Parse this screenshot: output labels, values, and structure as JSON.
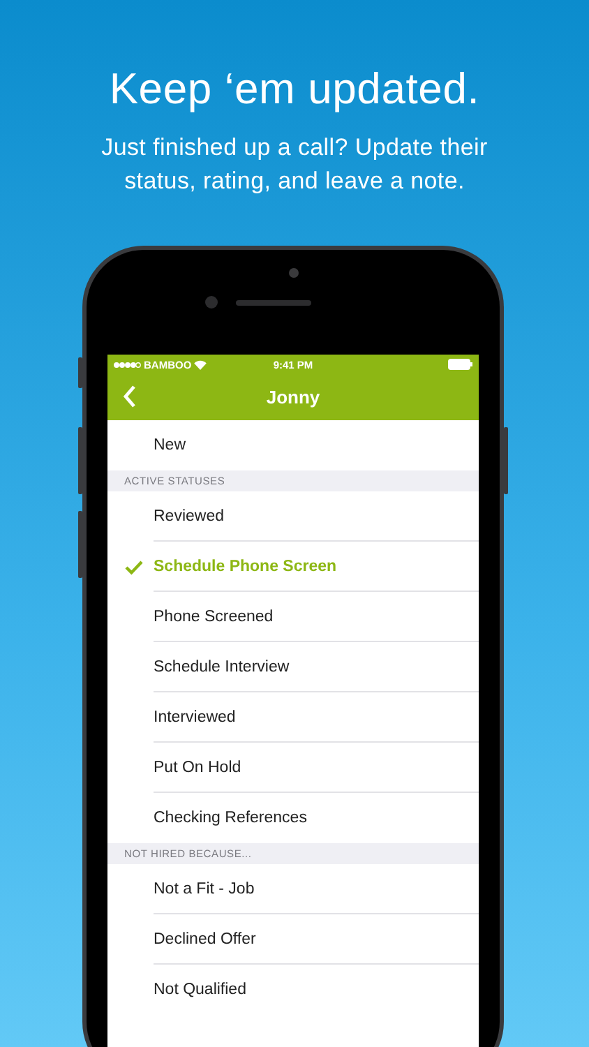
{
  "headline": "Keep ‘em updated.",
  "subtitle": "Just finished up a call? Update their status, rating, and leave a note.",
  "status_bar": {
    "carrier": "BAMBOO",
    "time": "9:41 PM"
  },
  "nav_bar": {
    "title": "Jonny"
  },
  "sections": [
    {
      "items": [
        {
          "label": "New",
          "selected": false
        }
      ]
    },
    {
      "header": "ACTIVE STATUSES",
      "items": [
        {
          "label": "Reviewed",
          "selected": false
        },
        {
          "label": "Schedule Phone Screen",
          "selected": true
        },
        {
          "label": "Phone Screened",
          "selected": false
        },
        {
          "label": "Schedule Interview",
          "selected": false
        },
        {
          "label": "Interviewed",
          "selected": false
        },
        {
          "label": "Put On Hold",
          "selected": false
        },
        {
          "label": "Checking References",
          "selected": false
        }
      ]
    },
    {
      "header": "NOT HIRED BECAUSE...",
      "items": [
        {
          "label": "Not a Fit - Job",
          "selected": false
        },
        {
          "label": "Declined Offer",
          "selected": false
        },
        {
          "label": "Not Qualified",
          "selected": false
        }
      ]
    }
  ]
}
